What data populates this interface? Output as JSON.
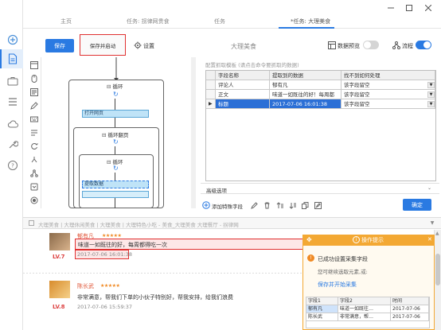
{
  "tabs": [
    {
      "label": "主页"
    },
    {
      "label": "任务: 拐律网贵食"
    },
    {
      "label": "任务"
    },
    {
      "label": "*任务: 大理美食"
    }
  ],
  "toolbar": {
    "save_label": "保存",
    "save_start_label": "保存并启动",
    "settings_label": "设置",
    "task_name": "大理美食",
    "preview_label": "数据预览",
    "flow_label": "流程"
  },
  "workflow": {
    "loop1_label": "循环",
    "open_page_label": "打开网页",
    "paging_label": "循环翻页",
    "loop2_label": "循环",
    "extract_label": "提取数据"
  },
  "config": {
    "hint": "配置抓取模板 (请点击命令要抓取的数据)",
    "columns": [
      "字段名称",
      "提取到的数据",
      "找不到如何处理"
    ],
    "rows": [
      {
        "marker": "",
        "field": "评论人",
        "value": "郁有凡",
        "handling": "该字段留空",
        "selected": false
      },
      {
        "marker": "",
        "field": "正文",
        "value": "味道一如既往的好！每周都",
        "handling": "该字段留空",
        "selected": false
      },
      {
        "marker": "▶",
        "field": "标题",
        "value": "2017-07-06 16:01:38",
        "handling": "该字段留空",
        "selected": true
      }
    ],
    "advanced_label": "高级选项",
    "add_field_label": "添加特殊字段",
    "confirm_label": "确定"
  },
  "url_bar": {
    "text": "大理美食 | 大理休闲美食 | 大理美食 | 大理特色小吃 - 美食_大理美食 大理餐厅 - 拐律网"
  },
  "reviews": [
    {
      "name": "郁有凡",
      "stars": "★★★★★",
      "level": "LV.7",
      "text": "味道一如既往的好，每周都得吃一次",
      "date": "2017-07-06 16:01:38"
    },
    {
      "name": "陈长武",
      "stars": "★★★★★",
      "level": "LV.8",
      "text": "非常满意，帮我们下单的小伙子特别好，帮我安排，给我们浪费",
      "date": "2017-07-06 15:59:37"
    }
  ],
  "popup": {
    "title": "操作提示",
    "success": "已成功设置采集字段",
    "next_hint": "您可继续选取元素,或:",
    "action": "保存并开始采集",
    "columns": [
      "字段1",
      "字段2",
      "时间"
    ],
    "rows": [
      [
        "郁有凡",
        "味道一如既往…",
        "2017-07-06"
      ],
      [
        "陈长武",
        "非常满意，帮…",
        "2017-07-06"
      ]
    ]
  },
  "colors": {
    "accent": "#2a7ae2",
    "selected_row": "#2b6fd6",
    "popup_header": "#f3a833",
    "star": "#f08a24",
    "highlight_border": "#e03030"
  }
}
